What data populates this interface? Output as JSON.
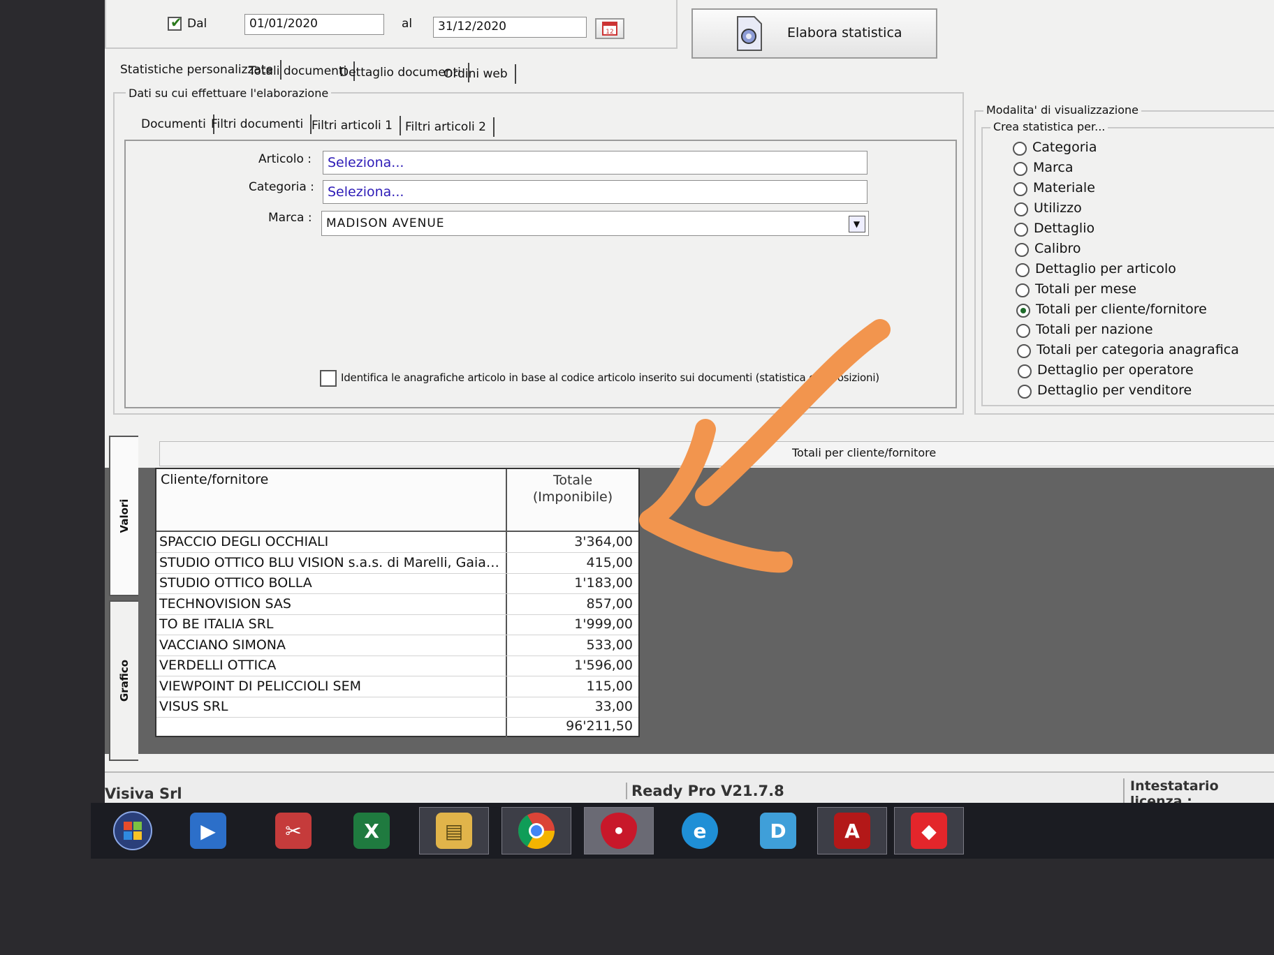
{
  "top": {
    "dal_label": "Dal",
    "dal_value": "01/01/2020",
    "al_label": "al",
    "al_value": "31/12/2020",
    "process_button": "Elabora statistica"
  },
  "main_tabs": [
    "Statistiche personalizzate",
    "Totali documenti",
    "Dettaglio documenti",
    "Ordini web"
  ],
  "data_group_title": "Dati su cui effettuare l'elaborazione",
  "sub_tabs": [
    "Documenti",
    "Filtri documenti",
    "Filtri articoli 1",
    "Filtri articoli 2"
  ],
  "filters": {
    "articolo_label": "Articolo :",
    "articolo_value": "Seleziona...",
    "categoria_label": "Categoria :",
    "categoria_value": "Seleziona...",
    "marca_label": "Marca :",
    "marca_value": "MADISON AVENUE",
    "identify_checkbox": "Identifica le anagrafiche articolo in base al codice articolo inserito sui documenti (statistica composizioni)"
  },
  "display_mode": {
    "group_title": "Modalita' di visualizzazione",
    "subgroup_title": "Crea statistica per...",
    "options": [
      "Categoria",
      "Marca",
      "Materiale",
      "Utilizzo",
      "Dettaglio",
      "Calibro",
      "Dettaglio per articolo",
      "Totali per mese",
      "Totali per cliente/fornitore",
      "Totali per nazione",
      "Totali per categoria anagrafica",
      "Dettaglio per operatore",
      "Dettaglio per venditore"
    ],
    "selected": "Totali per cliente/fornitore"
  },
  "results": {
    "caption": "Totali per cliente/fornitore",
    "side_tabs": [
      "Valori",
      "Grafico"
    ],
    "col_client": "Cliente/fornitore",
    "col_total": "Totale\n(Imponibile)",
    "rows": [
      {
        "name": "SPACCIO DEGLI OCCHIALI",
        "total": "3'364,00"
      },
      {
        "name": "STUDIO OTTICO BLU VISION s.a.s. di Marelli, Gaian...",
        "total": "415,00"
      },
      {
        "name": "STUDIO OTTICO BOLLA",
        "total": "1'183,00"
      },
      {
        "name": "TECHNOVISION  SAS",
        "total": "857,00"
      },
      {
        "name": "TO BE ITALIA SRL",
        "total": "1'999,00"
      },
      {
        "name": "VACCIANO SIMONA",
        "total": "533,00"
      },
      {
        "name": "VERDELLI OTTICA",
        "total": "1'596,00"
      },
      {
        "name": "VIEWPOINT DI PELICCIOLI SEM",
        "total": "115,00"
      },
      {
        "name": "VISUS SRL",
        "total": "33,00"
      }
    ],
    "grand_total": "96'211,50"
  },
  "status_bar": {
    "company": "Visiva Srl",
    "version": "Ready Pro V21.7.8",
    "license": "Intestatario licenza :"
  },
  "colors": {
    "annotation_arrow": "#f2954e"
  },
  "taskbar": [
    "start-orb-icon",
    "media-player-icon",
    "snipping-tool-icon",
    "excel-icon",
    "file-explorer-icon",
    "chrome-icon",
    "strawberry-app-icon",
    "edge-icon",
    "d-app-icon",
    "acrobat-icon",
    "anydesk-icon"
  ]
}
